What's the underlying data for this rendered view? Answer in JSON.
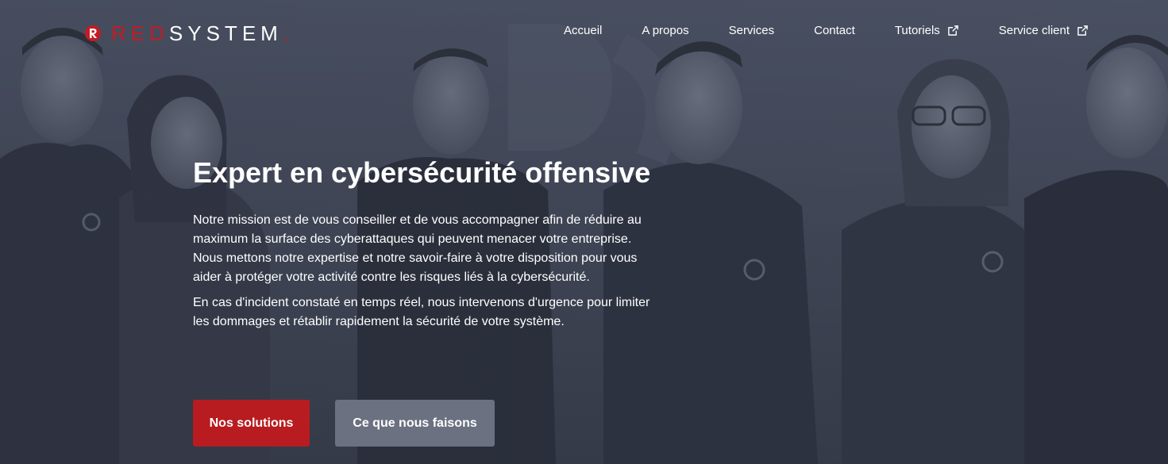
{
  "brand": {
    "name_red": "RED",
    "name_white": "SYSTEM",
    "dot": ".",
    "accent_color": "#c21c24"
  },
  "nav": {
    "items": [
      {
        "label": "Accueil",
        "external": false
      },
      {
        "label": "A propos",
        "external": false
      },
      {
        "label": "Services",
        "external": false
      },
      {
        "label": "Contact",
        "external": false
      },
      {
        "label": "Tutoriels",
        "external": true,
        "icon": "external-link-icon"
      },
      {
        "label": "Service client",
        "external": true,
        "icon": "external-link-icon"
      }
    ]
  },
  "hero": {
    "title": "Expert en cybersécurité offensive",
    "paragraph_1": "Notre mission est de vous conseiller et de vous accompagner afin de réduire au maximum la surface des cyberattaques qui peuvent menacer votre entreprise. Nous mettons notre expertise et notre savoir-faire à votre disposition pour vous aider à protéger votre activité contre les risques liés à la cybersécurité.",
    "paragraph_2": "En cas d'incident constaté en temps réel, nous intervenons d'urgence pour limiter les dommages et rétablir rapidement la sécurité de votre système.",
    "primary_button": "Nos solutions",
    "secondary_button": "Ce que nous faisons",
    "primary_color": "#b81c20",
    "secondary_color": "#6b7180"
  }
}
